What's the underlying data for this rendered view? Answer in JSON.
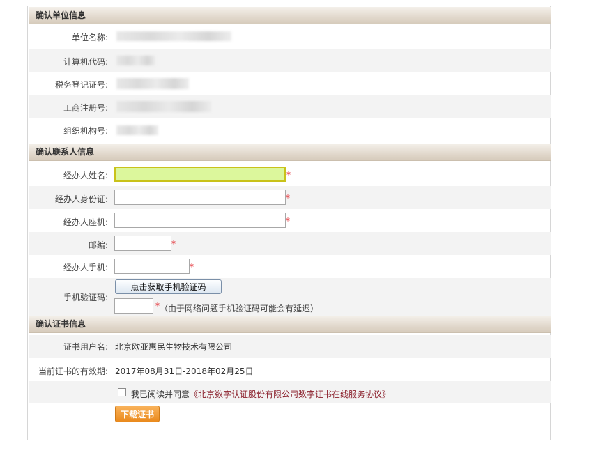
{
  "section_unit": {
    "title": "确认单位信息",
    "fields": [
      {
        "label": "单位名称:"
      },
      {
        "label": "计算机代码:"
      },
      {
        "label": "税务登记证号:"
      },
      {
        "label": "工商注册号:"
      },
      {
        "label": "组织机构号:"
      }
    ]
  },
  "section_contact": {
    "title": "确认联系人信息",
    "name_label": "经办人姓名:",
    "id_label": "经办人身份证:",
    "phone_label": "经办人座机:",
    "zip_label": "邮编:",
    "mobile_label": "经办人手机:",
    "sms_code_label": "手机验证码:",
    "sms_button": "点击获取手机验证码",
    "sms_note": "（由于网络问题手机验证码可能会有延迟）",
    "required_mark": "*",
    "name_value": "",
    "id_value": "",
    "phone_value": "",
    "zip_value": "",
    "mobile_value": "",
    "sms_code_value": ""
  },
  "section_cert": {
    "title": "确认证书信息",
    "user_label": "证书用户名:",
    "user_value": "北京欧亚惠民生物技术有限公司",
    "validity_label": "当前证书的有效期:",
    "validity_value": "2017年08月31日-2018年02月25日",
    "agree_text": "我已阅读并同意",
    "agree_link": "《北京数字认证股份有限公司数字证书在线服务协议》",
    "agree_checked": false,
    "download_button": "下载证书"
  },
  "colors": {
    "focus_input_bg": "#dcf79c",
    "required": "#e3242b",
    "download_button": "#ea8a1d",
    "agreement_link": "#8a1e2a"
  }
}
